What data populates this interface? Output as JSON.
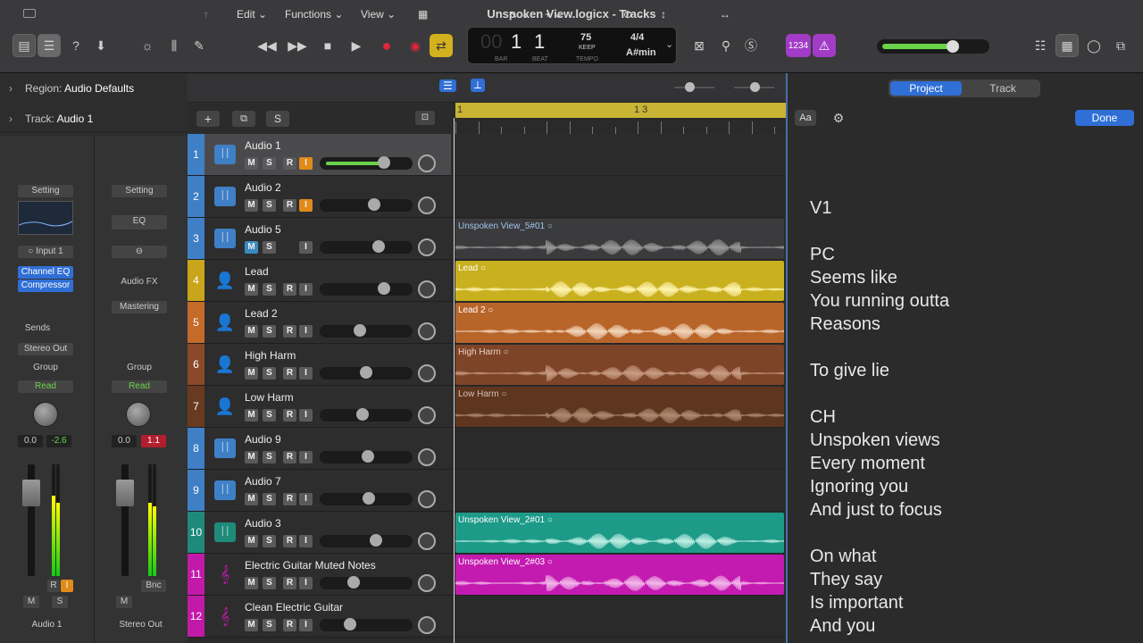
{
  "window": {
    "title": "Unspoken View.logicx - Tracks"
  },
  "lcd": {
    "bar": "1",
    "beat": "1",
    "bar_label": "BAR",
    "beat_label": "BEAT",
    "tempo": "75",
    "tempo_mode": "KEEP",
    "tempo_label": "TEMPO",
    "signature": "4/4",
    "key": "A#min",
    "dim_prefix": "00"
  },
  "toolbar": {
    "counter_label": "1234"
  },
  "inspector": {
    "region_label": "Region:",
    "region_value": "Audio Defaults",
    "track_label": "Track:",
    "track_value": "Audio 1",
    "left_strip": {
      "setting": "Setting",
      "input": "Input 1",
      "plugin1": "Channel EQ",
      "plugin2": "Compressor",
      "sends": "Sends",
      "output": "Stereo Out",
      "group": "Group",
      "automation": "Read",
      "vol": "0.0",
      "peak": "-2.6",
      "r": "R",
      "i": "I",
      "m": "M",
      "s": "S",
      "name": "Audio 1"
    },
    "right_strip": {
      "setting": "Setting",
      "eq": "EQ",
      "audiofx": "Audio FX",
      "mastering": "Mastering",
      "group": "Group",
      "automation": "Read",
      "vol": "0.0",
      "peak": "1.1",
      "bnc": "Bnc",
      "m": "M",
      "name": "Stereo Out"
    }
  },
  "tracks_toolbar": {
    "edit": "Edit",
    "functions": "Functions",
    "view": "View",
    "add": "+",
    "s": "S"
  },
  "ruler": {
    "start": "1",
    "marker": "1 3"
  },
  "tracks": [
    {
      "num": "1",
      "name": "Audio 1",
      "color": "#3f7fc6",
      "vol": 0.72,
      "i_on": true,
      "type": "audio"
    },
    {
      "num": "2",
      "name": "Audio 2",
      "color": "#3f7fc6",
      "vol": 0.6,
      "i_on": true,
      "type": "audio"
    },
    {
      "num": "3",
      "name": "Audio 5",
      "color": "#3f7fc6",
      "vol": 0.66,
      "m_on": true,
      "type": "audio"
    },
    {
      "num": "4",
      "name": "Lead",
      "color": "#c9a51c",
      "vol": 0.72,
      "type": "person"
    },
    {
      "num": "5",
      "name": "Lead 2",
      "color": "#c46a2a",
      "vol": 0.42,
      "type": "person"
    },
    {
      "num": "6",
      "name": "High Harm",
      "color": "#8a4a2a",
      "vol": 0.5,
      "type": "person"
    },
    {
      "num": "7",
      "name": "Low Harm",
      "color": "#6a3a20",
      "vol": 0.46,
      "type": "person"
    },
    {
      "num": "8",
      "name": "Audio 9",
      "color": "#3f7fc6",
      "vol": 0.52,
      "type": "audio"
    },
    {
      "num": "9",
      "name": "Audio 7",
      "color": "#3f7fc6",
      "vol": 0.53,
      "type": "audio"
    },
    {
      "num": "10",
      "name": "Audio 3",
      "color": "#1f8a7a",
      "vol": 0.62,
      "type": "audio"
    },
    {
      "num": "11",
      "name": "Electric Guitar Muted Notes",
      "color": "#c21aa8",
      "vol": 0.34,
      "type": "guitar"
    },
    {
      "num": "12",
      "name": "Clean Electric Guitar",
      "color": "#c21aa8",
      "vol": 0.3,
      "type": "guitar"
    }
  ],
  "regions": [
    {
      "track": 2,
      "name": "Unspoken View_5#01",
      "bg": "#3b3b3d",
      "fg": "#9a9a9a",
      "namecolor": "#9fc4f0"
    },
    {
      "track": 3,
      "name": "Lead",
      "bg": "#c9b01f",
      "fg": "#fff5b0",
      "namecolor": "#fff"
    },
    {
      "track": 4,
      "name": "Lead 2",
      "bg": "#b8652a",
      "fg": "#f3d6bc",
      "namecolor": "#fff"
    },
    {
      "track": 5,
      "name": "High Harm",
      "bg": "#7e4428",
      "fg": "#c99d85",
      "namecolor": "#e8d0c0"
    },
    {
      "track": 6,
      "name": "Low Harm",
      "bg": "#5e3620",
      "fg": "#b08a70",
      "namecolor": "#d8c0b0"
    },
    {
      "track": 9,
      "name": "Unspoken View_2#01",
      "bg": "#1d9a88",
      "fg": "#bff0e5",
      "namecolor": "#fff"
    },
    {
      "track": 10,
      "name": "Unspoken View_2#03",
      "bg": "#c31ab0",
      "fg": "#f3b8ea",
      "namecolor": "#fff"
    }
  ],
  "notes": {
    "tab_project": "Project",
    "tab_track": "Track",
    "font_btn": "Aa",
    "done": "Done",
    "lines": [
      "V1",
      "",
      "PC",
      "Seems like",
      "You running outta",
      "Reasons",
      "",
      "To give lie",
      "",
      "CH",
      "Unspoken views",
      "Every moment",
      "Ignoring you",
      "And just to focus",
      "",
      "On what",
      "They say",
      "Is important",
      "And you"
    ]
  },
  "colors": {
    "accent": "#2f6fd6",
    "record": "#e0263a",
    "cycle": "#d3b01e",
    "input_monitor": "#e08a1a"
  }
}
